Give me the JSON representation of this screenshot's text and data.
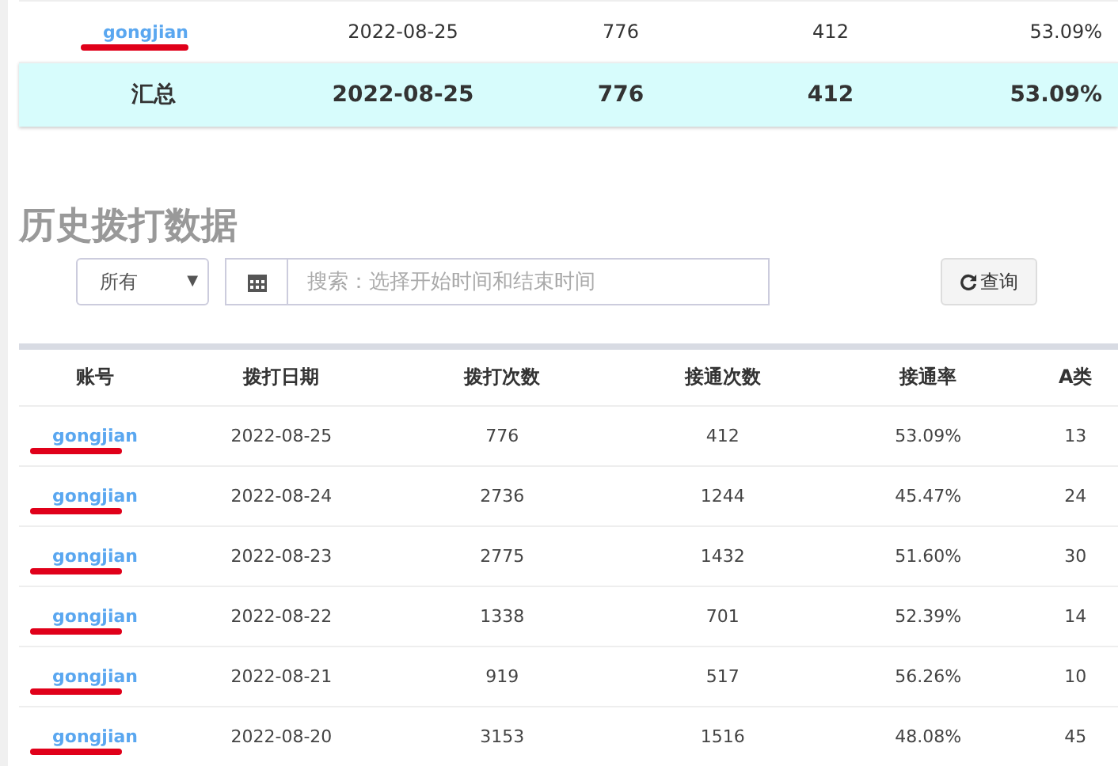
{
  "summary_table": {
    "rows": [
      {
        "cells": [
          "gongjian",
          "2022-08-25",
          "776",
          "412",
          "53.09%"
        ],
        "redacted": true
      },
      {
        "cells": [
          "汇总",
          "2022-08-25",
          "776",
          "412",
          "53.09%"
        ],
        "kind": "total"
      }
    ]
  },
  "history": {
    "title": "历史拨打数据",
    "filter": {
      "value": "所有",
      "caret": "▼"
    },
    "search": {
      "placeholder": "搜索：选择开始时间和结束时间"
    },
    "query_button": "查询",
    "table": {
      "columns": [
        "账号",
        "拨打日期",
        "拨打次数",
        "接通次数",
        "接通率",
        "A类"
      ],
      "rows": [
        {
          "cells": [
            "gongjian",
            "2022-08-25",
            "776",
            "412",
            "53.09%",
            "13"
          ],
          "redacted": true
        },
        {
          "cells": [
            "gongjian",
            "2022-08-24",
            "2736",
            "1244",
            "45.47%",
            "24"
          ],
          "redacted": true
        },
        {
          "cells": [
            "gongjian",
            "2022-08-23",
            "2775",
            "1432",
            "51.60%",
            "30"
          ],
          "redacted": true
        },
        {
          "cells": [
            "gongjian",
            "2022-08-22",
            "1338",
            "701",
            "52.39%",
            "14"
          ],
          "redacted": true
        },
        {
          "cells": [
            "gongjian",
            "2022-08-21",
            "919",
            "517",
            "56.26%",
            "10"
          ],
          "redacted": true
        },
        {
          "cells": [
            "gongjian",
            "2022-08-20",
            "3153",
            "1516",
            "48.08%",
            "45"
          ],
          "redacted": true
        }
      ]
    }
  }
}
